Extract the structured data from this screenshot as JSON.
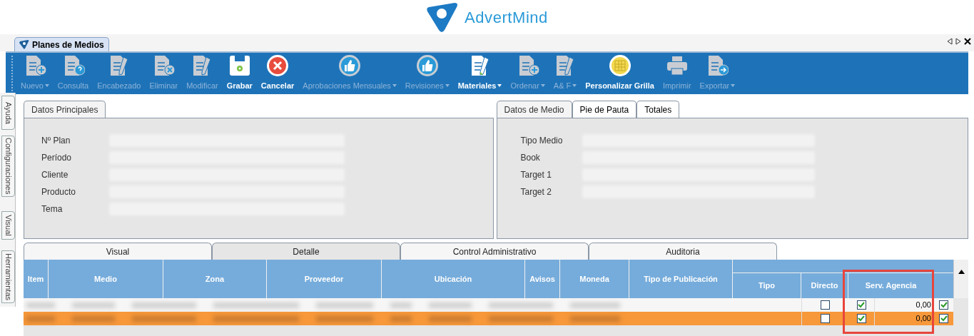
{
  "header": {
    "brand_light": "Advert",
    "brand_bold": "Mind"
  },
  "document_tab": {
    "label": "Planes de Medios",
    "selected": true
  },
  "toolbar": [
    {
      "label": "Nuevo",
      "kind": "newdoc",
      "disabled": true,
      "dropdown": true
    },
    {
      "label": "Consulta",
      "kind": "query",
      "disabled": true,
      "dropdown": false
    },
    {
      "label": "Encabezado",
      "kind": "edit",
      "disabled": true,
      "dropdown": false
    },
    {
      "label": "Eliminar",
      "kind": "delete",
      "disabled": true,
      "dropdown": false
    },
    {
      "label": "Modificar",
      "kind": "edit",
      "disabled": true,
      "dropdown": false
    },
    {
      "label": "Grabar",
      "kind": "save",
      "disabled": false,
      "dropdown": false
    },
    {
      "label": "Cancelar",
      "kind": "cancel",
      "disabled": false,
      "dropdown": false
    },
    {
      "label": "Aprobaciones Mensuales",
      "kind": "approve",
      "disabled": true,
      "dropdown": true
    },
    {
      "label": "Revisiones",
      "kind": "approve",
      "disabled": true,
      "dropdown": true
    },
    {
      "label": "Materiales",
      "kind": "edit",
      "disabled": false,
      "dropdown": true
    },
    {
      "label": "Ordenar",
      "kind": "newdoc",
      "disabled": true,
      "dropdown": true
    },
    {
      "label": "A& F",
      "kind": "edit",
      "disabled": true,
      "dropdown": true
    },
    {
      "label": "Personalizar Grilla",
      "kind": "grid",
      "disabled": false,
      "dropdown": false
    },
    {
      "label": "Imprimir",
      "kind": "print",
      "disabled": true,
      "dropdown": false
    },
    {
      "label": "Exportar",
      "kind": "export",
      "disabled": true,
      "dropdown": true
    }
  ],
  "side_tabs": [
    "Ayuda",
    "Configuraciones",
    "Visual",
    "Herramientas"
  ],
  "main_panel": {
    "tabs": [
      {
        "label": "Datos Principales",
        "selected": true
      }
    ],
    "fields": [
      "Nº Plan",
      "Período",
      "Cliente",
      "Producto",
      "Tema"
    ]
  },
  "media_panel": {
    "tabs": [
      {
        "label": "Datos de Medio",
        "selected": true
      },
      {
        "label": "Pie de Pauta",
        "selected": false
      },
      {
        "label": "Totales",
        "selected": false
      }
    ],
    "fields": [
      "Tipo Medio",
      "Book",
      "Target 1",
      "Target 2"
    ]
  },
  "detail_tabs": [
    {
      "label": "Visual",
      "selected": false
    },
    {
      "label": "Detalle",
      "selected": true
    },
    {
      "label": "Control Administrativo",
      "selected": false
    },
    {
      "label": "Auditoria",
      "selected": false
    }
  ],
  "grid": {
    "columns": [
      "Item",
      "Medio",
      "Zona",
      "Proveedor",
      "Ubicación",
      "Avisos",
      "Moneda",
      "Tipo de Publicación"
    ],
    "group_columns": [
      {
        "label": "Tipo",
        "highlighted": false
      },
      {
        "label": "Directo",
        "highlighted": false
      },
      {
        "label": "Serv. Agencia",
        "highlighted": true
      }
    ],
    "rows": [
      {
        "selected": false,
        "directo": false,
        "serv_agencia": true,
        "amount": "0,00",
        "last_check": true
      },
      {
        "selected": true,
        "directo": false,
        "serv_agencia": true,
        "amount": "0,00",
        "last_check": true
      }
    ]
  }
}
